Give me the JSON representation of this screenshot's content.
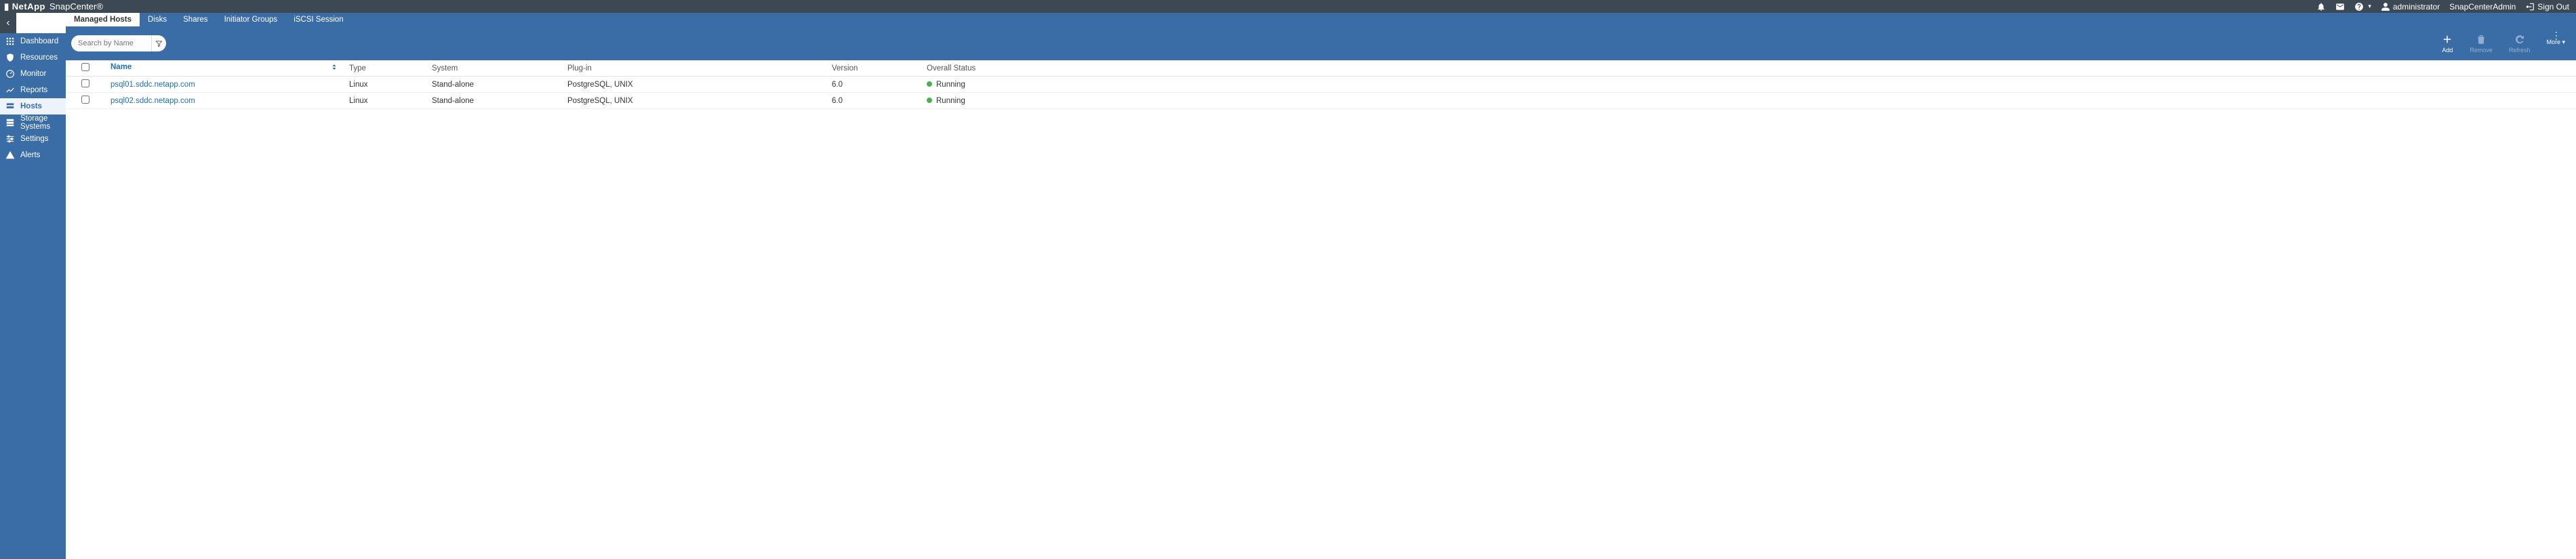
{
  "header": {
    "brand_prefix": "▮ NetApp",
    "product": "SnapCenter®",
    "user": "administrator",
    "role": "SnapCenterAdmin",
    "sign_out": "Sign Out"
  },
  "sidebar": {
    "items": [
      {
        "id": "dashboard",
        "label": "Dashboard"
      },
      {
        "id": "resources",
        "label": "Resources"
      },
      {
        "id": "monitor",
        "label": "Monitor"
      },
      {
        "id": "reports",
        "label": "Reports"
      },
      {
        "id": "hosts",
        "label": "Hosts"
      },
      {
        "id": "storage",
        "label": "Storage Systems"
      },
      {
        "id": "settings",
        "label": "Settings"
      },
      {
        "id": "alerts",
        "label": "Alerts"
      }
    ],
    "active": "hosts"
  },
  "tabs": [
    {
      "id": "managed",
      "label": "Managed Hosts",
      "active": true
    },
    {
      "id": "disks",
      "label": "Disks"
    },
    {
      "id": "shares",
      "label": "Shares"
    },
    {
      "id": "igroups",
      "label": "Initiator Groups"
    },
    {
      "id": "iscsi",
      "label": "iSCSI Session"
    }
  ],
  "search": {
    "placeholder": "Search by Name"
  },
  "actions": {
    "add": "Add",
    "remove": "Remove",
    "refresh": "Refresh",
    "more": "More"
  },
  "columns": {
    "name": "Name",
    "type": "Type",
    "system": "System",
    "plugin": "Plug-in",
    "version": "Version",
    "status": "Overall Status"
  },
  "rows": [
    {
      "name": "psql01.sddc.netapp.com",
      "type": "Linux",
      "system": "Stand-alone",
      "plugin": "PostgreSQL, UNIX",
      "version": "6.0",
      "status": "Running",
      "status_color": "#4caf50"
    },
    {
      "name": "psql02.sddc.netapp.com",
      "type": "Linux",
      "system": "Stand-alone",
      "plugin": "PostgreSQL, UNIX",
      "version": "6.0",
      "status": "Running",
      "status_color": "#4caf50"
    }
  ]
}
